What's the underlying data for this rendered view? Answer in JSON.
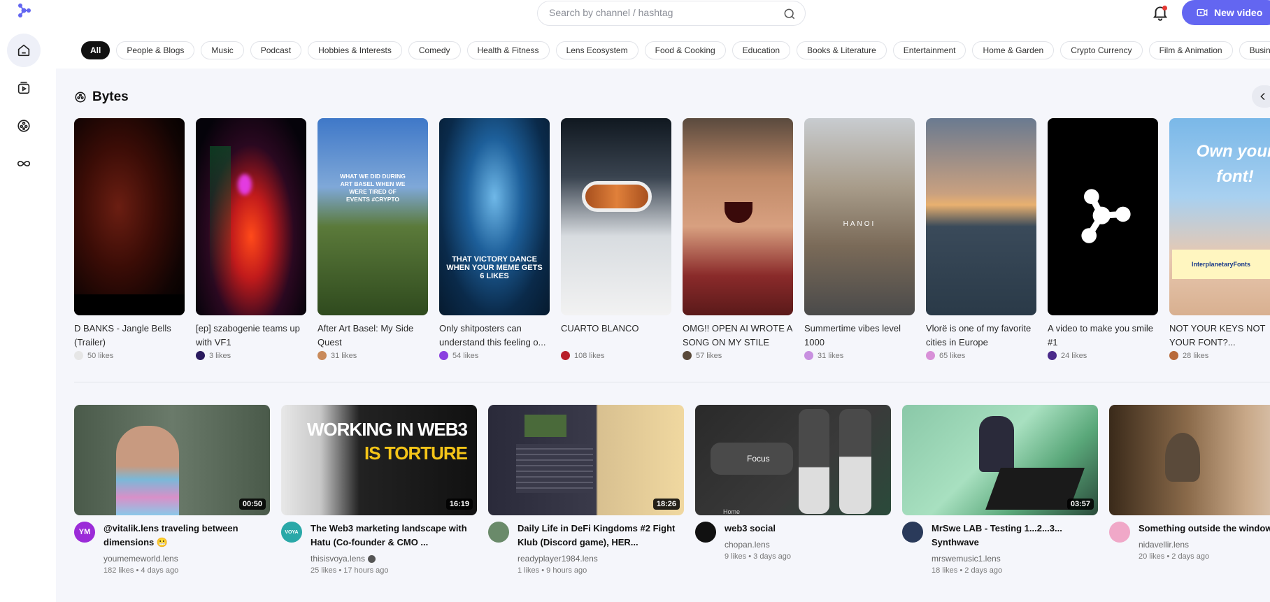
{
  "header": {
    "search_placeholder": "Search by channel / hashtag",
    "new_video_label": "New video",
    "accent_color": "#6366f1"
  },
  "sidebar": {
    "items": [
      {
        "icon": "home-icon",
        "active": true
      },
      {
        "icon": "video-icon",
        "active": false
      },
      {
        "icon": "bytes-reel-icon",
        "active": false
      },
      {
        "icon": "infinity-icon",
        "active": false
      }
    ]
  },
  "categories": [
    "All",
    "People & Blogs",
    "Music",
    "Podcast",
    "Hobbies & Interests",
    "Comedy",
    "Health & Fitness",
    "Lens Ecosystem",
    "Food & Cooking",
    "Education",
    "Books & Literature",
    "Entertainment",
    "Home & Garden",
    "Crypto Currency",
    "Film & Animation",
    "Business"
  ],
  "bytes": {
    "title": "Bytes",
    "items": [
      {
        "title": "D BANKS - Jangle Bells (Trailer)",
        "likes": "50 likes",
        "thumb_text": ""
      },
      {
        "title": "[ep] szabogenie teams up with VF1",
        "likes": "3 likes",
        "thumb_text": ""
      },
      {
        "title": "After Art Basel: My Side Quest",
        "likes": "31 likes",
        "thumb_text": "WHAT WE DID DURING ART BASEL WHEN WE WERE TIRED OF EVENTS #CRYPTO"
      },
      {
        "title": "Only shitposters can understand this feeling o...",
        "likes": "54 likes",
        "thumb_text": "THAT VICTORY DANCE WHEN YOUR MEME GETS 6 LIKES"
      },
      {
        "title": "CUARTO BLANCO",
        "likes": "108 likes",
        "thumb_text": ""
      },
      {
        "title": "OMG!! OPEN AI WROTE A SONG ON MY STILE",
        "likes": "57 likes",
        "thumb_text": ""
      },
      {
        "title": "Summertime vibes level 1000",
        "likes": "31 likes",
        "thumb_text": "HANOI"
      },
      {
        "title": "Vlorë is one of my favorite cities in Europe",
        "likes": "65 likes",
        "thumb_text": ""
      },
      {
        "title": "A video to make you smile #1",
        "likes": "24 likes",
        "thumb_text": ""
      },
      {
        "title": "NOT YOUR KEYS NOT YOUR FONT?...",
        "likes": "28 likes",
        "thumb_text": "Own your font!",
        "thumb_banner": "InterplanetaryFonts"
      }
    ]
  },
  "videos": [
    {
      "title": "@vitalik.lens traveling between dimensions 😬",
      "channel": "youmemeworld.lens",
      "likes": "182 likes",
      "age": "4 days ago",
      "duration": "00:50",
      "avatar_text": "YM",
      "verified": false
    },
    {
      "title": "The Web3 marketing landscape with Hatu (Co-founder & CMO ...",
      "channel": "thisisvoya.lens",
      "likes": "25 likes",
      "age": "17 hours ago",
      "duration": "16:19",
      "avatar_text": "VOYA",
      "verified": true,
      "thumb_text_1": "WORKING IN WEB3",
      "thumb_text_2": "IS TORTURE"
    },
    {
      "title": "Daily Life in DeFi Kingdoms #2 Fight Klub (Discord game), HER...",
      "channel": "readyplayer1984.lens",
      "likes": "1 likes",
      "age": "9 hours ago",
      "duration": "18:26",
      "avatar_text": "",
      "verified": false
    },
    {
      "title": "web3 social",
      "channel": "chopan.lens",
      "likes": "9 likes",
      "age": "3 days ago",
      "duration": "",
      "avatar_text": "",
      "verified": false,
      "thumb_text_1": "Focus",
      "thumb_text_2": "Home"
    },
    {
      "title": "MrSwe LAB - Testing 1...2...3... Synthwave",
      "channel": "mrswemusic1.lens",
      "likes": "18 likes",
      "age": "2 days ago",
      "duration": "03:57",
      "avatar_text": "",
      "verified": false
    },
    {
      "title": "Something outside the window",
      "channel": "nidavellir.lens",
      "likes": "20 likes",
      "age": "2 days ago",
      "duration": "",
      "avatar_text": "",
      "verified": false
    }
  ]
}
